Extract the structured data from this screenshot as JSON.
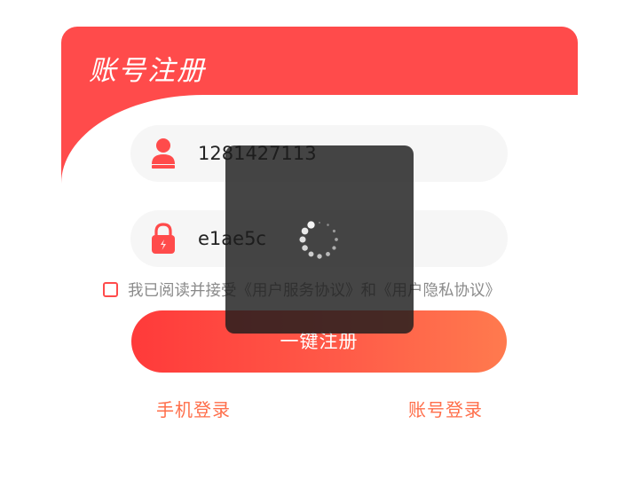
{
  "register": {
    "title": "账号注册",
    "phone_value": "1281427113",
    "password_value": "e1ae5c",
    "agreement_text": "我已阅读并接受《用户服务协议》和《用户隐私协议》",
    "agreement_checked": false,
    "register_button": "一键注册",
    "phone_login_link": "手机登录",
    "account_login_link": "账号登录"
  },
  "icons": {
    "phone_field_icon": "user-icon",
    "password_field_icon": "lock-icon",
    "loading_icon": "spinner-icon"
  },
  "colors": {
    "brand": "#ff4b4b",
    "button_gradient_start": "#ff3a3a",
    "button_gradient_end": "#ff7a4e",
    "link": "#ff6e4a",
    "overlay": "#1c1c1c"
  },
  "loading": {
    "visible": true
  }
}
